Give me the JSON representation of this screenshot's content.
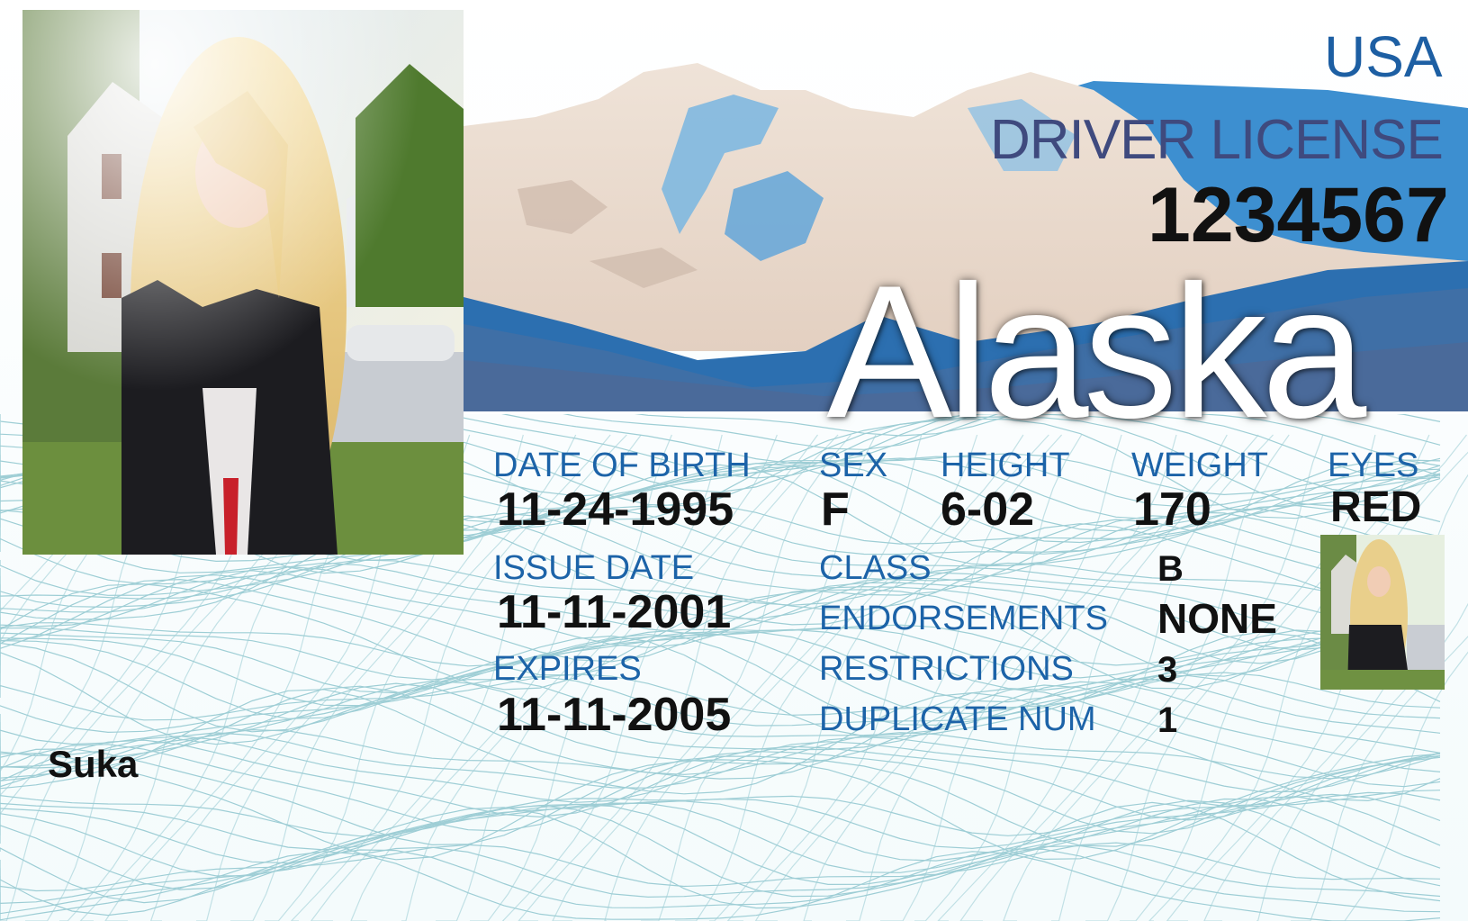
{
  "header": {
    "country": "USA",
    "document_type": "DRIVER LICENSE",
    "license_number": "1234567",
    "state": "Alaska"
  },
  "fields": {
    "dob": {
      "label": "DATE OF BIRTH",
      "value": "11-24-1995"
    },
    "sex": {
      "label": "SEX",
      "value": "F"
    },
    "height": {
      "label": "HEIGHT",
      "value": "6-02"
    },
    "weight": {
      "label": "WEIGHT",
      "value": "170"
    },
    "eyes": {
      "label": "EYES",
      "value": "RED"
    },
    "issue_date": {
      "label": "ISSUE DATE",
      "value": "11-11-2001"
    },
    "expires": {
      "label": "EXPIRES",
      "value": "11-11-2005"
    },
    "class": {
      "label": "CLASS",
      "value": "B"
    },
    "endorsements": {
      "label": "ENDORSEMENTS",
      "value": "NONE"
    },
    "restrictions": {
      "label": "RESTRICTIONS",
      "value": "3"
    },
    "duplicate": {
      "label": "DUPLICATE NUM",
      "value": "1"
    }
  },
  "holder": {
    "signature": "Suka"
  },
  "colors": {
    "label_blue": "#1c63a8",
    "title_blue": "#1d5fa3",
    "license_navy": "#3f4a7e",
    "mountain_beige": "#e8d8cb",
    "water_blue": "#5fa3d6",
    "deep_blue": "#2c6fb0",
    "guilloche": "#8fc6cf"
  },
  "icons": {
    "photo": "holder-portrait-photo",
    "ghost_photo": "holder-ghost-image",
    "background": "mountain-landscape-art",
    "security": "guilloche-pattern"
  }
}
